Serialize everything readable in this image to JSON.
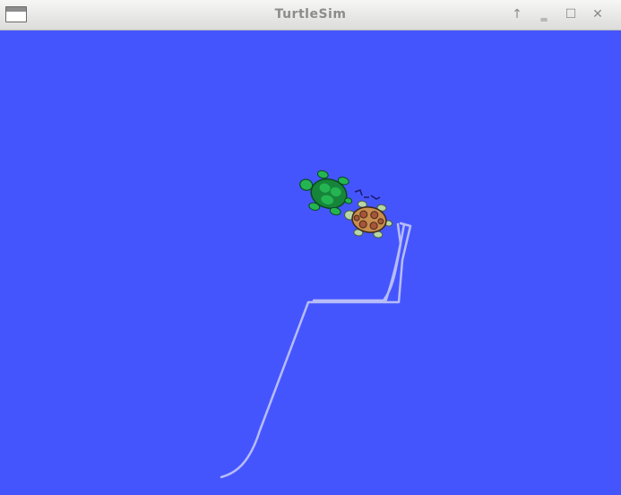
{
  "window": {
    "title": "TurtleSim",
    "buttons": [
      {
        "name": "keep-above-button",
        "glyph": "↑"
      },
      {
        "name": "minimize-button",
        "glyph": "‗"
      },
      {
        "name": "maximize-button",
        "glyph": "☐"
      },
      {
        "name": "close-button",
        "glyph": "✕"
      }
    ]
  },
  "canvas": {
    "background": "#4555fe",
    "pen_color": "#b5baf7",
    "turtles": [
      {
        "name": "turtle-green",
        "shell": "#1e9a45"
      },
      {
        "name": "turtle-orange",
        "shell": "#c88e4f"
      }
    ]
  }
}
